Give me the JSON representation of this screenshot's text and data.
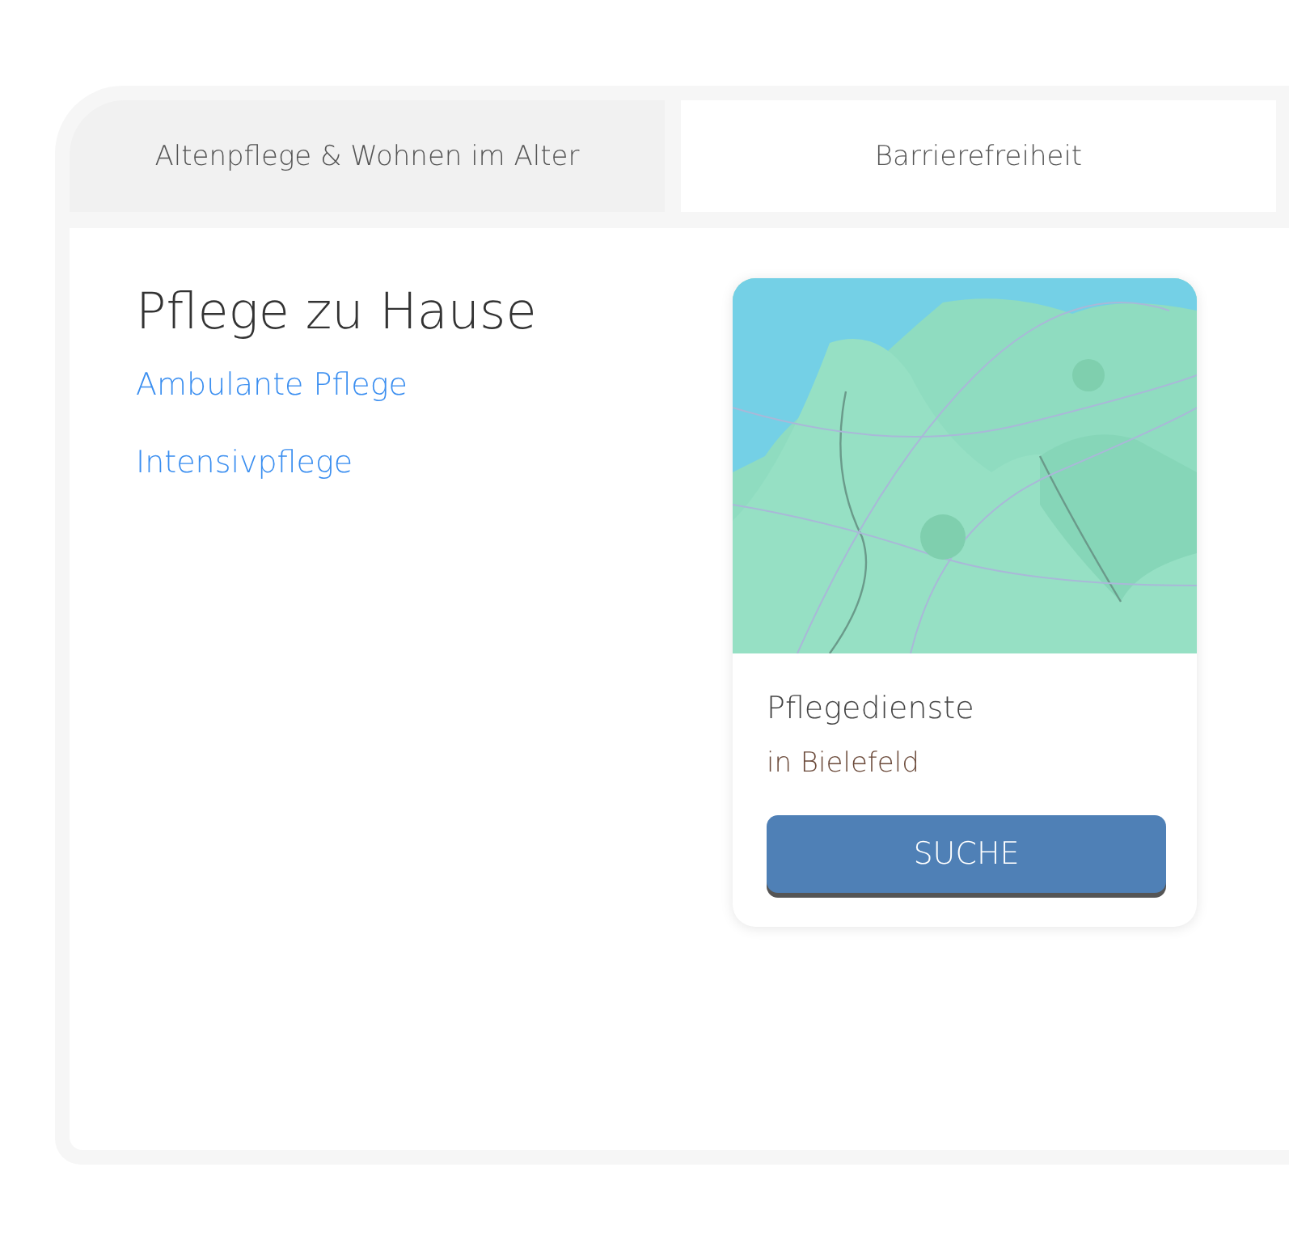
{
  "tabs": [
    {
      "label": "Altenpflege & Wohnen im Alter",
      "selected": true
    },
    {
      "label": "Barrierefreiheit",
      "selected": false
    }
  ],
  "section": {
    "title": "Pflege zu Hause",
    "links": [
      "Ambulante Pflege",
      "Intensivpflege"
    ]
  },
  "card": {
    "title": "Pflegedienste",
    "subtitle": "in Bielefeld",
    "button": "SUCHE"
  }
}
